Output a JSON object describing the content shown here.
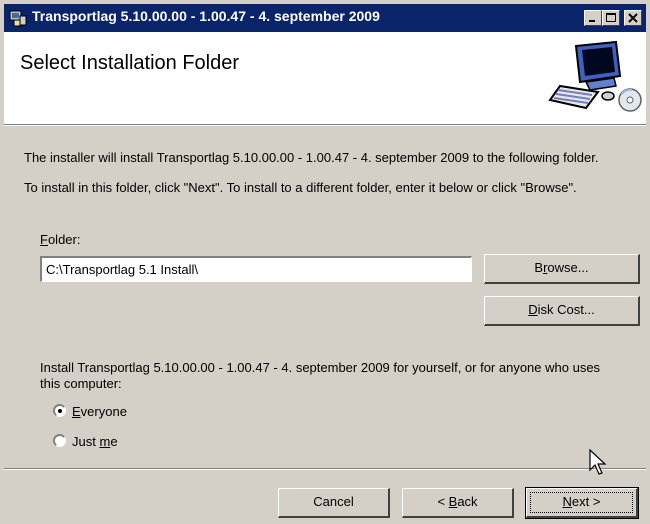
{
  "window": {
    "title": "Transportlag 5.10.00.00 - 1.00.47 - 4. september 2009",
    "controls": [
      "minimize-icon",
      "maximize-icon",
      "close-icon"
    ]
  },
  "header": {
    "title": "Select Installation Folder",
    "icon": "computer-cd-icon"
  },
  "body": {
    "line1": "The installer will install Transportlag 5.10.00.00 - 1.00.47 - 4. september 2009 to the following folder.",
    "line2": "To install in this folder, click \"Next\". To install to a different folder, enter it below or click \"Browse\".",
    "folder_label": "Folder:",
    "folder_value": "C:\\Transportlag 5.1 Install\\",
    "browse_label": "Browse...",
    "disk_cost_label": "Disk Cost...",
    "install_for_line1": "Install Transportlag 5.10.00.00 - 1.00.47 - 4. september 2009 for yourself, or for anyone who uses",
    "install_for_line2": "this computer:",
    "radio_options": [
      {
        "label": "Everyone",
        "selected": true
      },
      {
        "label": "Just me",
        "selected": false
      }
    ]
  },
  "footer": {
    "cancel_label": "Cancel",
    "back_label": "< Back",
    "next_label": "Next >"
  },
  "colors": {
    "titlebar": "#0a246a",
    "dialog_bg": "#d4d0c8"
  }
}
